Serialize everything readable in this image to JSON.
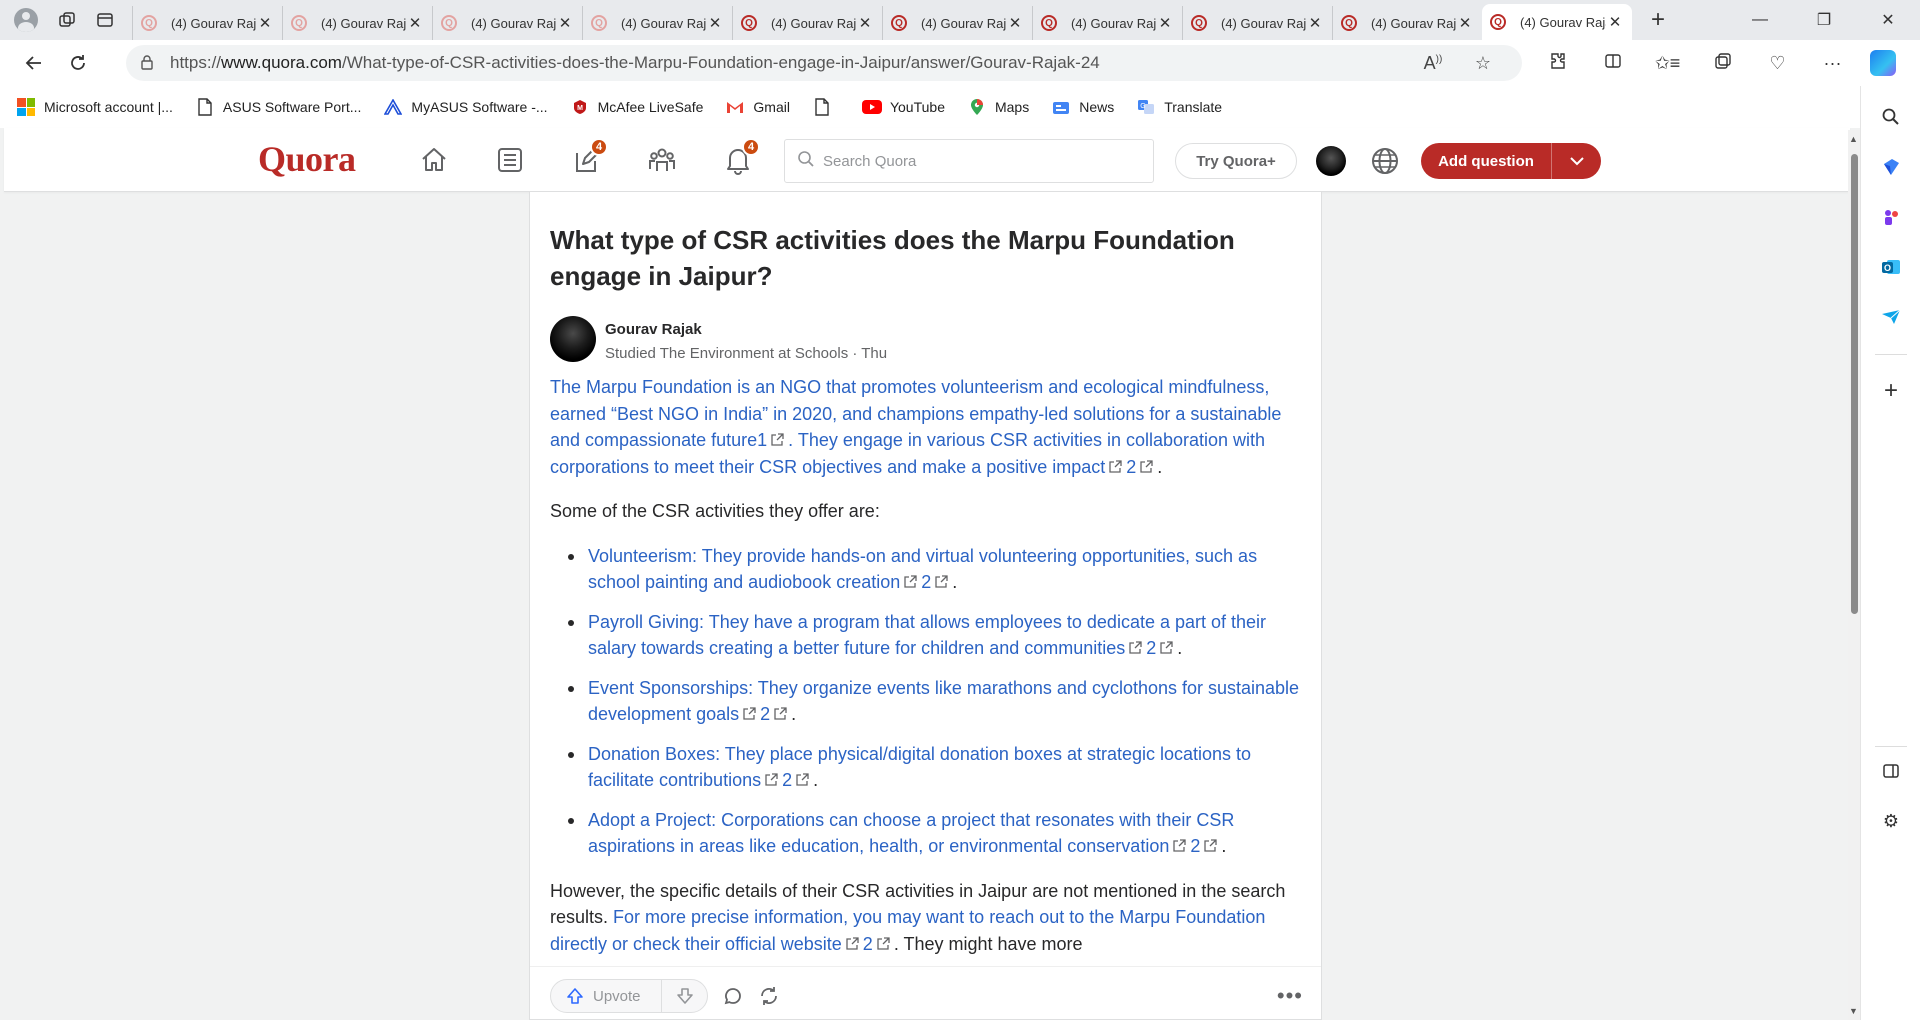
{
  "browser": {
    "tabs": [
      {
        "title": "(4) Gourav Rajak",
        "faded": true
      },
      {
        "title": "(4) Gourav Rajak",
        "faded": true
      },
      {
        "title": "(4) Gourav Rajak",
        "faded": true
      },
      {
        "title": "(4) Gourav Rajak",
        "faded": true
      },
      {
        "title": "(4) Gourav Rajak",
        "faded": false
      },
      {
        "title": "(4) Gourav Rajak",
        "faded": false
      },
      {
        "title": "(4) Gourav Rajak",
        "faded": false
      },
      {
        "title": "(4) Gourav Rajak",
        "faded": false
      },
      {
        "title": "(4) Gourav Rajak",
        "faded": false
      },
      {
        "title": "(4) Gourav Rajak",
        "faded": false,
        "active": true
      }
    ],
    "url_prefix": "https://",
    "url_host": "www.quora.com",
    "url_path": "/What-type-of-CSR-activities-does-the-Marpu-Foundation-engage-in-Jaipur/answer/Gourav-Rajak-24",
    "bookmarks": [
      {
        "label": "Microsoft account |...",
        "icon": "microsoft-logo"
      },
      {
        "label": "ASUS Software Port...",
        "icon": "page-icon"
      },
      {
        "label": "MyASUS Software -...",
        "icon": "myasus-icon"
      },
      {
        "label": "McAfee LiveSafe",
        "icon": "mcafee-icon"
      },
      {
        "label": "Gmail",
        "icon": "gmail-icon"
      },
      {
        "label": "",
        "icon": "page-icon"
      },
      {
        "label": "YouTube",
        "icon": "youtube-icon"
      },
      {
        "label": "Maps",
        "icon": "maps-icon"
      },
      {
        "label": "News",
        "icon": "news-icon"
      },
      {
        "label": "Translate",
        "icon": "translate-icon"
      }
    ]
  },
  "quora": {
    "logo": "Quora",
    "following_badge": "4",
    "notifications_badge": "4",
    "search_placeholder": "Search Quora",
    "try_plus": "Try Quora+",
    "add_question": "Add question"
  },
  "question": {
    "title": "What type of CSR activities does the Marpu Foundation engage in Jaipur?"
  },
  "author": {
    "name": "Gourav Rajak",
    "credential": "Studied The Environment at Schools · Thu"
  },
  "answer": {
    "p1_a": "The Marpu Foundation is an NGO that promotes volunteerism and ecological mindfulness, earned “Best NGO in India” in 2020, and champions empathy-led solutions for a sustainable and compassionate future1",
    "p1_b": ". They engage in various CSR activities in collaboration with corporations to meet their CSR objectives and make a positive impact",
    "p1_ref": "2",
    "p1_end": ".",
    "p2": "Some of the CSR activities they offer are:",
    "bullets": [
      "Volunteerism: They provide hands-on and virtual volunteering opportunities, such as school painting and audiobook creation",
      "Payroll Giving: They have a program that allows employees to dedicate a part of their salary towards creating a better future for children and communities",
      "Event Sponsorships: They organize events like marathons and cyclothons for sustainable development goals",
      "Donation Boxes: They place physical/digital donation boxes at strategic locations to facilitate contributions",
      "Adopt a Project: Corporations can choose a project that resonates with their CSR aspirations in areas like education, health, or environmental conservation"
    ],
    "bullet_ref": "2",
    "p3_a": "However, the specific details of their CSR activities in Jaipur are not mentioned in the search results.",
    "p3_b": "For more precise information, you may want to reach out to the Marpu Foundation directly or check their official website",
    "p3_ref": "2",
    "p3_c": ". They might have more"
  },
  "actions": {
    "upvote": "Upvote"
  },
  "colors": {
    "quora_red": "#b92b27",
    "link_blue": "#2b63c4"
  }
}
